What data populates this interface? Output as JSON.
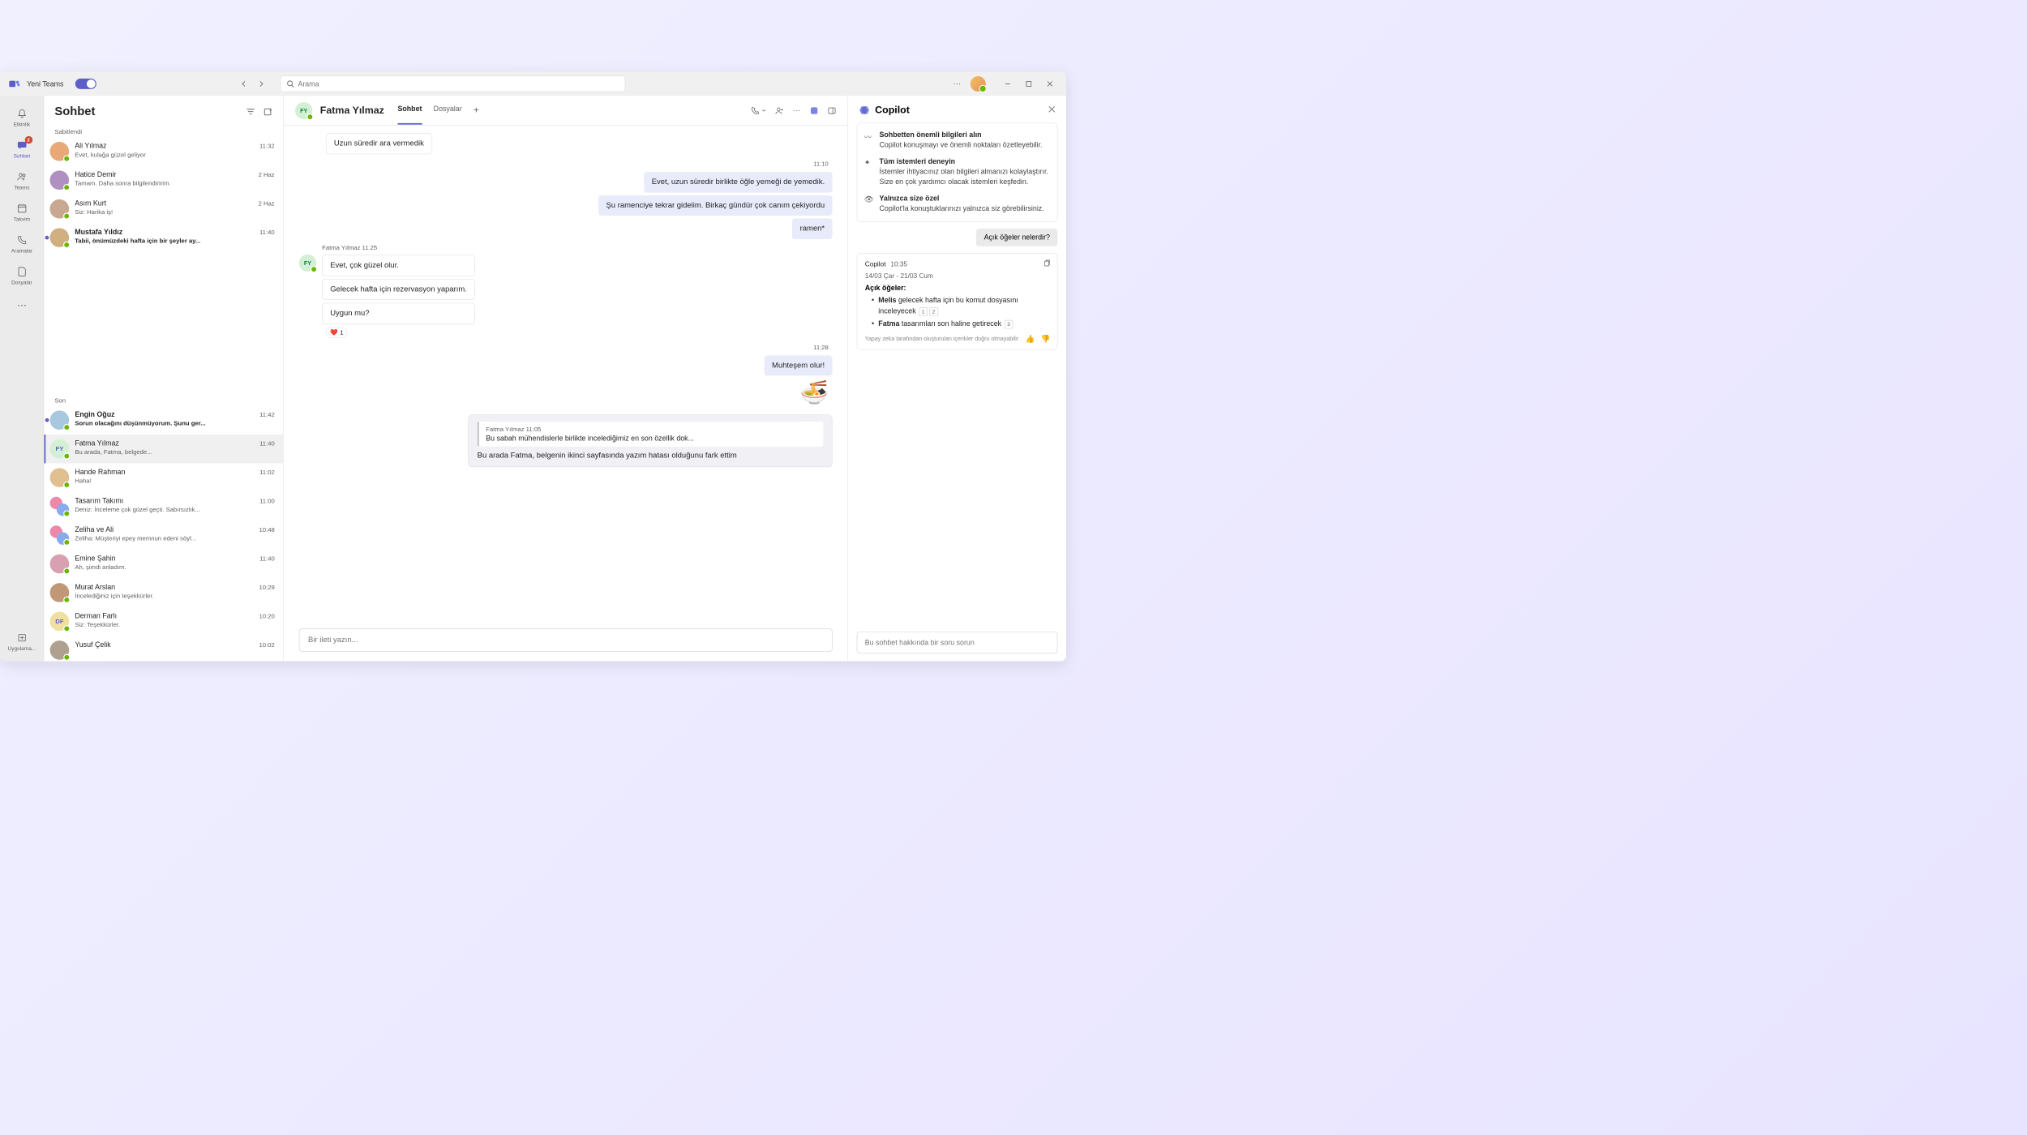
{
  "titlebar": {
    "brand": "Yeni Teams",
    "search_placeholder": "Arama"
  },
  "rail": {
    "items": [
      {
        "label": "Etkinlik",
        "icon": "bell"
      },
      {
        "label": "Sohbet",
        "icon": "chat",
        "active": true,
        "badge": "2"
      },
      {
        "label": "Teams",
        "icon": "teams"
      },
      {
        "label": "Takvim",
        "icon": "calendar"
      },
      {
        "label": "Aramalar",
        "icon": "call"
      },
      {
        "label": "Dosyalar",
        "icon": "file"
      },
      {
        "label": "",
        "icon": "more"
      },
      {
        "label": "Uygulama...",
        "icon": "apps"
      }
    ]
  },
  "chatlist": {
    "title": "Sohbet",
    "section_pinned": "Sabitlendi",
    "section_recent": "Son",
    "pinned": [
      {
        "name": "Ali Yılmaz",
        "preview": "Evet, kulağa güzel geliyor",
        "time": "11:32",
        "av": "#e8a878"
      },
      {
        "name": "Hatice Demir",
        "preview": "Tamam. Daha sonra bilgilendiririm.",
        "time": "2 Haz",
        "av": "#b090c0"
      },
      {
        "name": "Asım Kurt",
        "preview": "Siz: Harika iş!",
        "time": "2 Haz",
        "av": "#c8a890"
      },
      {
        "name": "Mustafa Yıldız",
        "preview": "Tabii, önümüzdeki hafta için bir şeyler ay...",
        "time": "11:40",
        "unread": true,
        "av": "#d0b080"
      }
    ],
    "recent": [
      {
        "name": "Engin Oğuz",
        "preview": "Sorun olacağını düşünmüyorum. Şunu ger...",
        "time": "11:42",
        "unread": true,
        "av": "#a8c8e0"
      },
      {
        "name": "Fatma Yılmaz",
        "preview": "Bu arada, Fatma, belgede...",
        "time": "11:40",
        "selected": true,
        "initials": "FY",
        "av": "#d4f0d4"
      },
      {
        "name": "Hande Rahman",
        "preview": "Haha!",
        "time": "11:02",
        "av": "#e0c090"
      },
      {
        "name": "Tasarım Takımı",
        "preview": "Deniz: İnceleme çok güzel geçti. Sabırsızlık...",
        "time": "11:00",
        "duo": true
      },
      {
        "name": "Zeliha ve Ali",
        "preview": "Zeliha: Müşteriyi epey memnun edeni söyl...",
        "time": "10:48",
        "duo": true
      },
      {
        "name": "Emine Şahin",
        "preview": "Ah, şimdi anladım.",
        "time": "11:40",
        "av": "#d8a0b0"
      },
      {
        "name": "Murat Arslan",
        "preview": "İncelediğiniz için teşekkürler.",
        "time": "10:29",
        "av": "#c09878"
      },
      {
        "name": "Derman Farlı",
        "preview": "Siz: Teşekkürler.",
        "time": "10:20",
        "initials": "DF",
        "av": "#f0e0a0"
      },
      {
        "name": "Yusuf Çelik",
        "preview": "",
        "time": "10:02",
        "av": "#b0a090"
      }
    ]
  },
  "chat": {
    "person": "Fatma Yılmaz",
    "initials": "FY",
    "tabs": {
      "chat": "Sohbet",
      "files": "Dosyalar"
    },
    "messages": {
      "m0": "Uzun süredir ara vermedik",
      "t1": "11:10",
      "m1": "Evet, uzun süredir birlikte öğle yemeği de yemedik.",
      "m2": "Şu ramenciye tekrar gidelim. Birkaç gündür çok canım çekiyordu",
      "m3": "ramen*",
      "meta2": "Fatma Yılmaz   11.25",
      "m4": "Evet, çok güzel olur.",
      "m5": "Gelecek hafta için rezervasyon yaparım.",
      "m6": "Uygun mu?",
      "reaction_count": "1",
      "t3": "11:28",
      "m7": "Muhteşem olur!",
      "emoji": "🍜",
      "quote_author": "Fatma Yılmaz   11:05",
      "quote_text": "Bu sabah mühendislerle birlikte incelediğimiz en son özellik dok...",
      "m8": "Bu arada Fatma, belgenin ikinci sayfasında yazım hatası olduğunu fark ettim"
    },
    "compose_placeholder": "Bir ileti yazın..."
  },
  "copilot": {
    "title": "Copilot",
    "tips": [
      {
        "icon": "〰",
        "title": "Sohbetten önemli bilgileri alın",
        "desc": "Copilot konuşmayı ve önemli noktaları özetleyebilir."
      },
      {
        "icon": "✦",
        "title": "Tüm istemleri deneyin",
        "desc": "İstemler ihtiyacınız olan bilgileri almanızı kolaylaştırır. Size en çok yardımcı olacak istemleri keşfedin."
      },
      {
        "icon": "👁",
        "title": "Yalnızca size özel",
        "desc": "Copilot'la konuştuklarınızı yalnızca siz görebilirsiniz."
      }
    ],
    "user_msg": "Açık öğeler nelerdir?",
    "resp_name": "Copilot",
    "resp_time": "10:35",
    "daterange": "14/03 Çar - 21/03 Cum",
    "resp_title": "Açık öğeler:",
    "item1_name": "Melis",
    "item1_rest": " gelecek hafta için bu komut dosyasını inceleyecek ",
    "item2_name": "Fatma",
    "item2_rest": " tasarımları son haline getirecek ",
    "ref1": "1",
    "ref2": "2",
    "ref3": "3",
    "disclaimer": "Yapay zeka tarafından oluşturulan içerikler doğru olmayabilir",
    "input_placeholder": "Bu sohbet hakkında bir soru sorun"
  }
}
